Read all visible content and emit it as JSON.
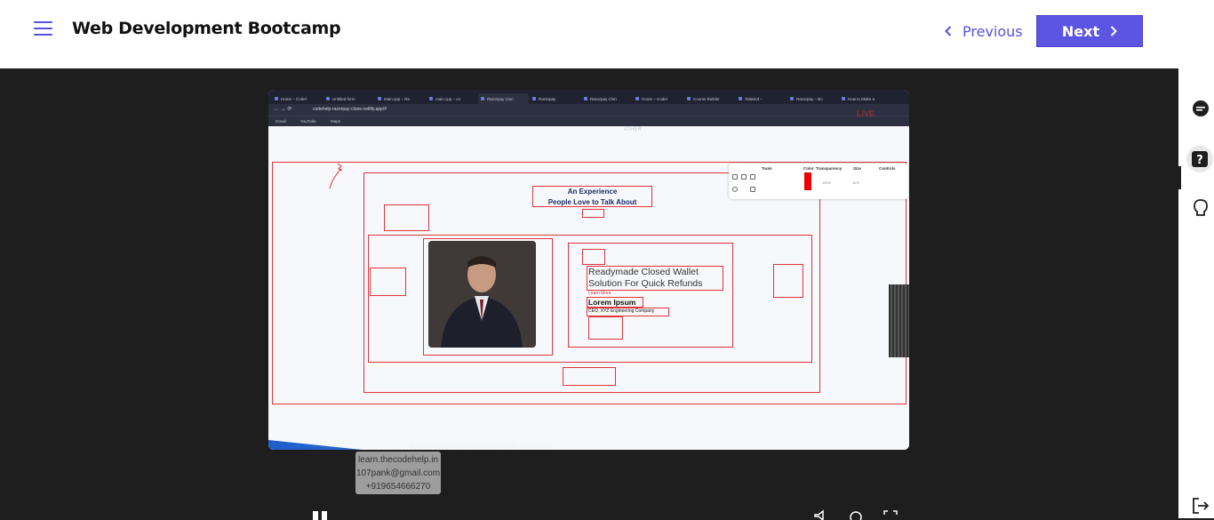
{
  "header": {
    "title": "Web Development Bootcamp",
    "prev_label": "Previous",
    "next_label": "Next",
    "accent": "#5c55e4"
  },
  "video": {
    "tabs": [
      "Home – Codel",
      "Untitled form",
      "main.cpp – Re",
      "main.cpp – co",
      "Razorpay Clon",
      "Razorpay",
      "Razorpay Clon",
      "Home – Codel",
      "Course Builder",
      "Tailwind –",
      "Razorpay – Bo",
      "How to Make a"
    ],
    "url": "codehelp-razorpay-clone.netlify.app/#",
    "bookmarks": [
      "Gmail",
      "YouTube",
      "Maps"
    ],
    "live": "LIVE",
    "heading_line1": "An Experience",
    "heading_line2": "People Love to Talk About",
    "quote_line1": "Readymade Closed Wallet",
    "quote_line2": "Solution For Quick Refunds",
    "learn_more": "Learn More",
    "name": "Lorem Ipsum",
    "company": "CEO, XYZ Engineering Company",
    "bottom_caption": "Supercharge your business with Razorpay",
    "toolbar": {
      "tools": "Tools",
      "color": "Color",
      "transparency": "Transparency",
      "size": "Size",
      "controls": "Controls",
      "transparency_value": "100%",
      "size_value": "15%"
    },
    "brand_faint": "ATHER"
  },
  "watermark": {
    "line1": "learn.thecodehelp.in",
    "line2": "107pank@gmail.com",
    "line3": "+919654666270"
  }
}
